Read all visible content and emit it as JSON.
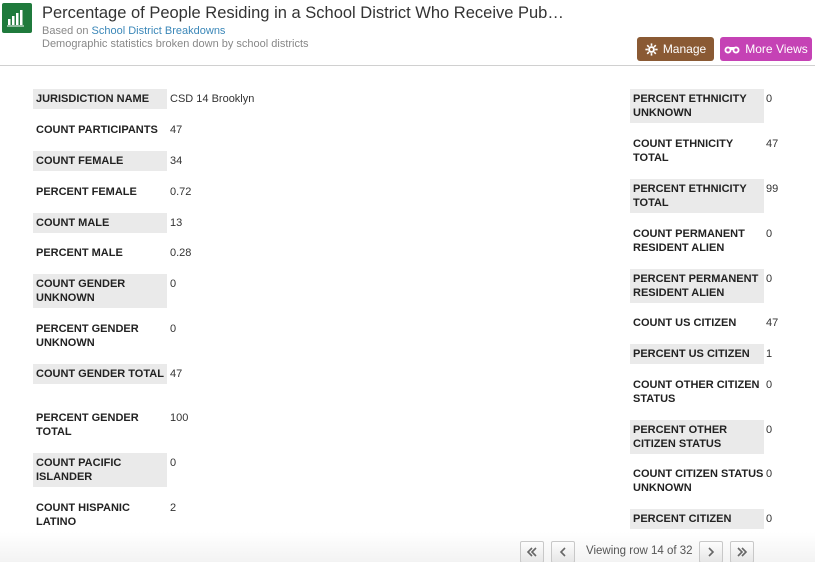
{
  "header": {
    "title": "Percentage of People Residing in a School District Who Receive Pub…",
    "based_on_prefix": "Based on",
    "based_on_link": "School District Breakdowns",
    "subtitle": "Demographic statistics broken down by school districts",
    "manage_label": "Manage",
    "more_views_label": "More Views",
    "manage_color": "#8a5a34",
    "more_views_color": "#c542b5",
    "app_icon": "bar-chart-icon"
  },
  "left_fields": [
    {
      "label": "JURISDICTION NAME",
      "value": "CSD 14 Brooklyn"
    },
    {
      "label": "COUNT PARTICIPANTS",
      "value": "47"
    },
    {
      "label": "COUNT FEMALE",
      "value": "34"
    },
    {
      "label": "PERCENT FEMALE",
      "value": "0.72"
    },
    {
      "label": "COUNT MALE",
      "value": "13"
    },
    {
      "label": "PERCENT MALE",
      "value": "0.28"
    },
    {
      "label": "COUNT GENDER UNKNOWN",
      "value": "0"
    },
    {
      "label": "PERCENT GENDER UNKNOWN",
      "value": "0"
    },
    {
      "label": "COUNT GENDER TOTAL",
      "value": "47"
    },
    {
      "label": "PERCENT GENDER TOTAL",
      "value": "100"
    },
    {
      "label": "COUNT PACIFIC ISLANDER",
      "value": "0"
    },
    {
      "label": "COUNT HISPANIC LATINO",
      "value": "2"
    }
  ],
  "right_fields": [
    {
      "label": "PERCENT ETHNICITY UNKNOWN",
      "value": "0"
    },
    {
      "label": "COUNT ETHNICITY TOTAL",
      "value": "47"
    },
    {
      "label": "PERCENT ETHNICITY TOTAL",
      "value": "99"
    },
    {
      "label": "COUNT PERMANENT RESIDENT ALIEN",
      "value": "0"
    },
    {
      "label": "PERCENT PERMANENT RESIDENT ALIEN",
      "value": "0"
    },
    {
      "label": "COUNT US CITIZEN",
      "value": "47"
    },
    {
      "label": "PERCENT US CITIZEN",
      "value": "1"
    },
    {
      "label": "COUNT OTHER CITIZEN STATUS",
      "value": "0"
    },
    {
      "label": "PERCENT OTHER CITIZEN STATUS",
      "value": "0"
    },
    {
      "label": "COUNT CITIZEN STATUS UNKNOWN",
      "value": "0"
    },
    {
      "label": "PERCENT CITIZEN",
      "value": "0"
    }
  ],
  "pager": {
    "text": "Viewing row 14 of 32"
  }
}
